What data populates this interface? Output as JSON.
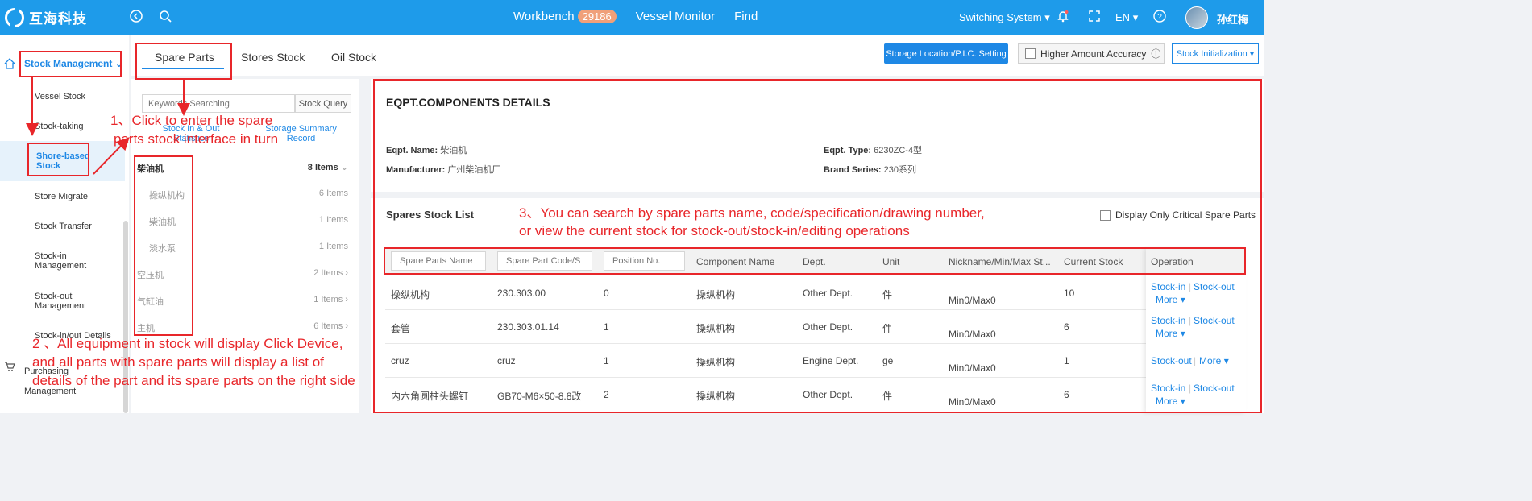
{
  "topbar": {
    "logo_text": "互海科技",
    "nav": [
      {
        "label": "Workbench",
        "badge": "29186"
      },
      {
        "label": "Vessel Monitor"
      },
      {
        "label": "Find"
      }
    ],
    "switching_system": "Switching System",
    "language": "EN",
    "user_name": "孙红梅"
  },
  "sidebar": {
    "group": "Stock Management",
    "items": [
      "Vessel Stock",
      "Stock-taking",
      "Shore-based Stock",
      "Store Migrate",
      "Stock Transfer",
      "Stock-in Management",
      "Stock-out Management",
      "Stock-in/out Details",
      "Purchasing Management"
    ]
  },
  "tabs": [
    "Spare Parts",
    "Stores Stock",
    "Oil Stock"
  ],
  "toolbar": {
    "storage_btn": "Storage Location/P.I.C. Setting",
    "accuracy_label": "Higher Amount Accuracy",
    "init_btn": "Stock Initialization"
  },
  "mid": {
    "search_placeholder": "Keywords Searching",
    "stock_query": "Stock Query",
    "link1": "Stock In & Out Statistics",
    "link2": "Storage Summary Record",
    "tree": [
      {
        "name": "柴油机",
        "count": "8 Items"
      },
      {
        "name": "操纵机构",
        "count": "6 Items"
      },
      {
        "name": "柴油机",
        "count": "1 Items"
      },
      {
        "name": "淡水泵",
        "count": "1 Items"
      },
      {
        "name": "空压机",
        "count": "2 Items"
      },
      {
        "name": "气缸油",
        "count": "1 Items"
      },
      {
        "name": "主机",
        "count": "6 Items"
      }
    ]
  },
  "detail": {
    "title": "EQPT.COMPONENTS DETAILS",
    "eqpt_name_label": "Eqpt. Name:",
    "eqpt_name": "柴油机",
    "eqpt_type_label": "Eqpt. Type:",
    "eqpt_type": "6230ZC-4型",
    "manufacturer_label": "Manufacturer:",
    "manufacturer": "广州柴油机厂",
    "brand_label": "Brand Series:",
    "brand": "230系列"
  },
  "list": {
    "title": "Spares Stock List",
    "critical_label": "Display Only Critical Spare Parts",
    "filters": [
      "Spare Parts Name",
      "Spare Part Code/S",
      "Position No."
    ],
    "columns": [
      "Component Name",
      "Dept.",
      "Unit",
      "Nickname/Min/Max St...",
      "Current Stock",
      "Operation"
    ],
    "rows": [
      {
        "name": "操纵机构",
        "code": "230.303.00",
        "pos": "0",
        "component": "操纵机构",
        "dept": "Other Dept.",
        "unit": "件",
        "minmax": "Min0/Max0",
        "stock": "10",
        "ops": [
          "Stock-in",
          "Stock-out",
          "More"
        ]
      },
      {
        "name": "套管",
        "code": "230.303.01.14",
        "pos": "1",
        "component": "操纵机构",
        "dept": "Other Dept.",
        "unit": "件",
        "minmax": "Min0/Max0",
        "stock": "6",
        "ops": [
          "Stock-in",
          "Stock-out",
          "More"
        ]
      },
      {
        "name": "cruz",
        "code": "cruz",
        "pos": "1",
        "component": "操纵机构",
        "dept": "Engine Dept.",
        "unit": "ge",
        "minmax": "Min0/Max0",
        "stock": "1",
        "ops": [
          "Stock-out",
          "More"
        ]
      },
      {
        "name": "内六角圆柱头螺钉",
        "code": "GB70-M6×50-8.8改",
        "pos": "2",
        "component": "操纵机构",
        "dept": "Other Dept.",
        "unit": "件",
        "minmax": "Min0/Max0",
        "stock": "6",
        "ops": [
          "Stock-in",
          "Stock-out",
          "More"
        ]
      }
    ]
  },
  "annotations": {
    "a1_line1": "1、Click to enter the spare",
    "a1_line2": "parts stock interface in turn",
    "a2_line1": "2 、All equipment in stock will display Click Device,",
    "a2_line2": "and all parts with spare parts will display a list of",
    "a2_line3": "details of the part and its spare parts on the right side",
    "a3_line1": "3、You can search by spare parts name, code/specification/drawing number,",
    "a3_line2": "or view the current stock for stock-out/stock-in/editing operations"
  },
  "colors": {
    "brand": "#1e9bea",
    "accent": "#1e88e5",
    "annotation": "#e8262a"
  }
}
